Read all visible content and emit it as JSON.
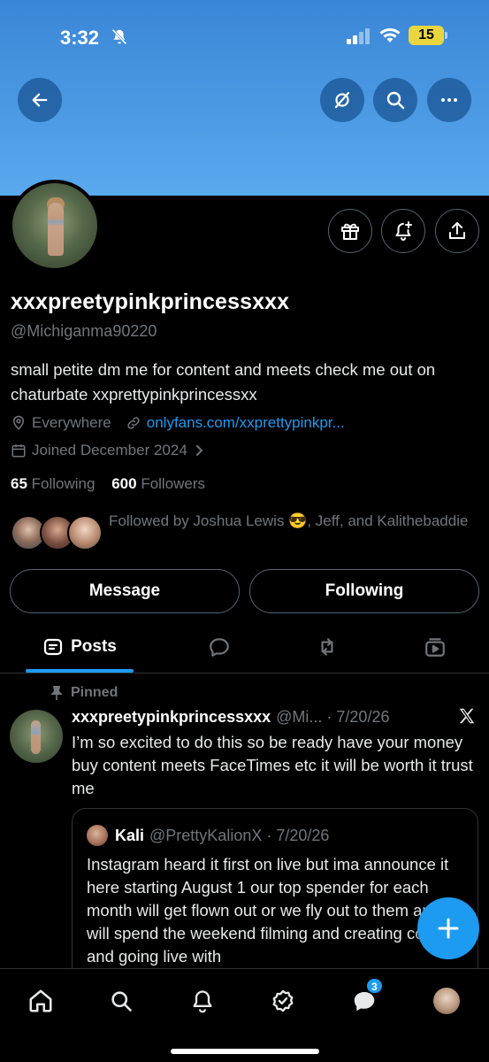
{
  "status_bar": {
    "time": "3:32",
    "battery": "15"
  },
  "profile": {
    "display_name": "xxxpreetypinkprincessxxx",
    "handle": "@Michiganma90220",
    "bio": "small petite dm me for content and meets check me out on chaturbate xxprettypinkprincessxx",
    "location": "Everywhere",
    "website": "onlyfans.com/xxprettypinkpr...",
    "joined": "Joined December 2024",
    "following_count": "65",
    "following_label": "Following",
    "followers_count": "600",
    "followers_label": "Followers",
    "followed_by": "Followed by Joshua Lewis 😎, Jeff, and Kalithebaddie"
  },
  "actions": {
    "message_label": "Message",
    "following_label": "Following"
  },
  "tabs": {
    "posts_label": "Posts"
  },
  "pinned_post": {
    "pinned_label": "Pinned",
    "author_name": "xxxpreetypinkprincessxxx",
    "author_meta": "@Mi... · 7/20/26",
    "text": "I’m so excited to do this so be ready have your money buy content meets FaceTimes etc it will be worth it trust me",
    "quote": {
      "author_name": "Kali",
      "author_meta": "@PrettyKalionX · 7/20/26",
      "text": "Instagram heard it first on live but ima announce it here starting  August 1 our top spender for each  month will get flown out or we fly out to them and will spend the weekend filming and creating content and going live with"
    }
  },
  "bottom_nav": {
    "messages_badge": "3"
  },
  "colors": {
    "accent": "#1d9bf0",
    "banner": "#4b99e3",
    "muted": "#71767b",
    "border": "#536471"
  }
}
